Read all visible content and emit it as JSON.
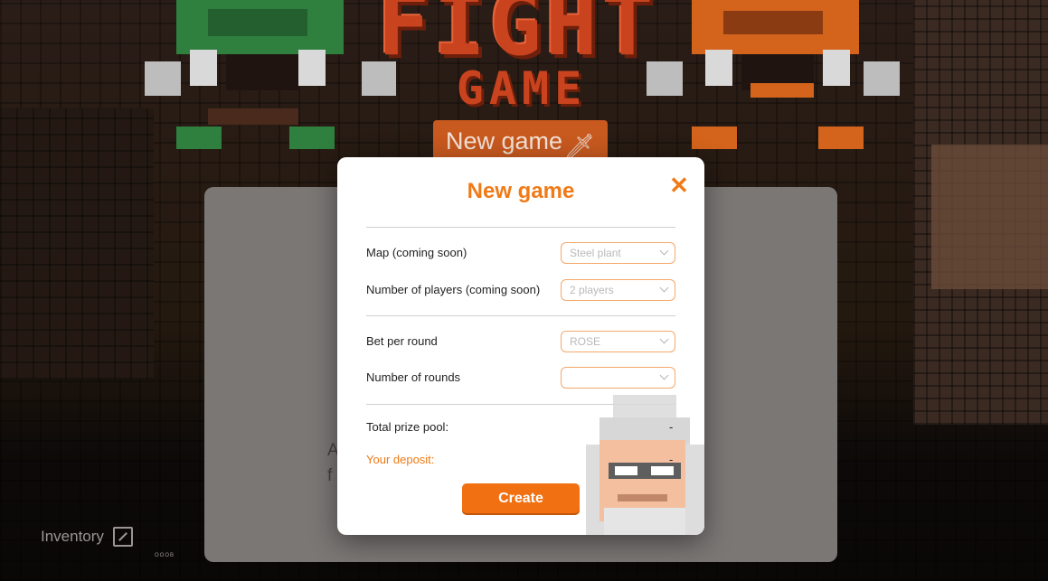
{
  "background": {
    "logo_title_top": "FIGHT",
    "logo_title_bottom": "GAME",
    "new_game_button_label": "New game",
    "inventory_label": "Inventory",
    "inventory_sublabel": "OOOB",
    "card_text_partial": "A f",
    "colors": {
      "accent": "#f07a17",
      "green_fighter": "#2f7f3e",
      "orange_fighter": "#d4641c"
    }
  },
  "modal": {
    "title": "New game",
    "close_icon": "close-icon",
    "fields": [
      {
        "label": "Map (coming soon)",
        "value": "Steel plant"
      },
      {
        "label": "Number of players (coming soon)",
        "value": "2 players"
      },
      {
        "label": "Bet per round",
        "value": "ROSE"
      },
      {
        "label": "Number of rounds",
        "value": ""
      }
    ],
    "total_prize_pool_label": "Total prize pool:",
    "total_prize_pool_value": "-",
    "your_deposit_label": "Your deposit:",
    "your_deposit_value": "-",
    "create_label": "Create"
  }
}
